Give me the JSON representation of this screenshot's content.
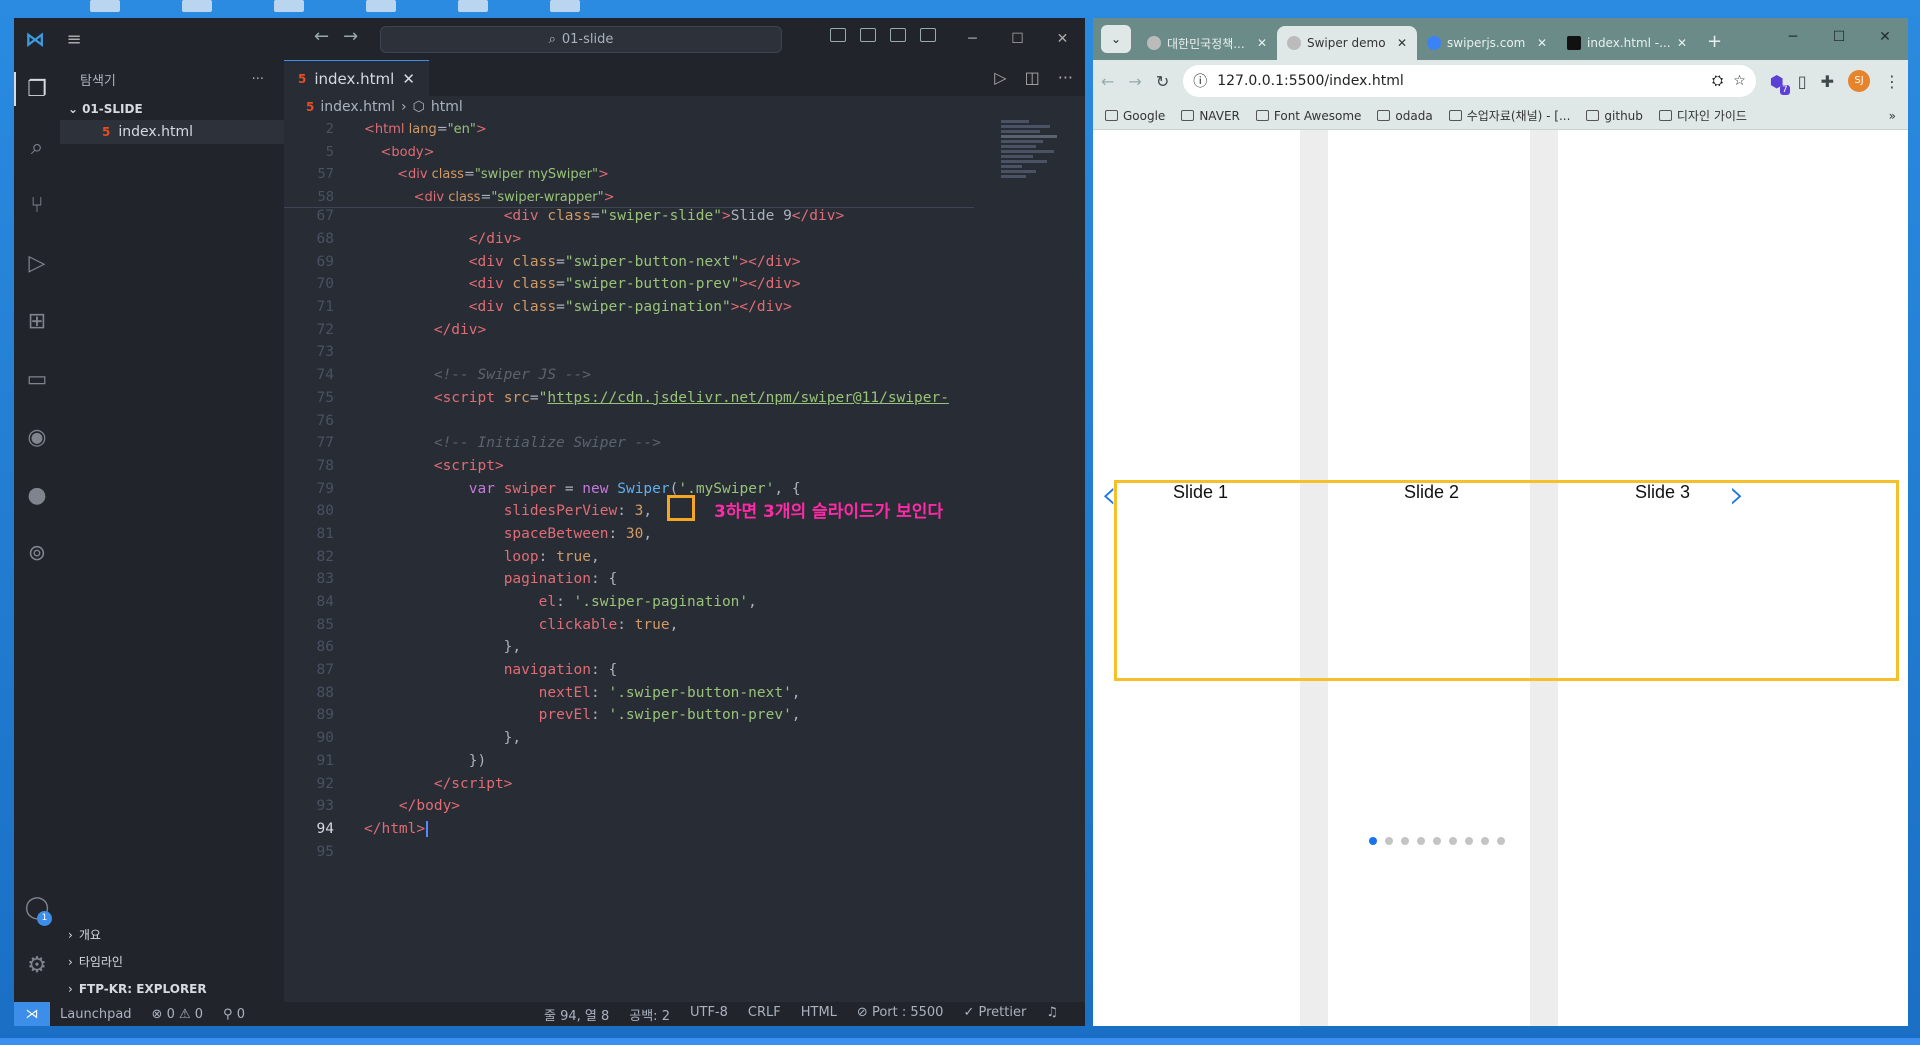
{
  "vscode": {
    "search_text": "01-slide",
    "explorer_title": "탐색기",
    "folder": "01-SLIDE",
    "file": "index.html",
    "tab_label": "index.html",
    "breadcrumb_file": "index.html",
    "breadcrumb_node": "html",
    "sections": [
      "개요",
      "타임라인",
      "FTP-KR: EXPLORER"
    ],
    "account_badge": "1",
    "annotation": "3하면 3개의 슬라이드가 보인다",
    "lines": [
      {
        "n": "2",
        "html": "<span class='tag'>&lt;html</span> <span class='attr'>lang</span>=<span class='str'>\"en\"</span><span class='tag'>&gt;</span>",
        "indent": 0
      },
      {
        "n": "5",
        "html": "<span class='tag'>&lt;body&gt;</span>",
        "indent": 1
      },
      {
        "n": "57",
        "html": "<span class='tag'>&lt;div</span> <span class='attr'>class</span>=<span class='str'>\"swiper mySwiper\"</span><span class='tag'>&gt;</span>",
        "indent": 2
      },
      {
        "n": "58",
        "html": "<span class='tag'>&lt;div</span> <span class='attr'>class</span>=<span class='str'>\"swiper-wrapper\"</span><span class='tag'>&gt;</span>",
        "indent": 3
      }
    ],
    "body_lines": [
      {
        "n": "67",
        "indent": 4,
        "html": "<span class='tag'>&lt;div</span> <span class='attr'>class</span>=<span class='str'>\"swiper-slide\"</span><span class='tag'>&gt;</span>Slide 9<span class='tag'>&lt;/div&gt;</span>"
      },
      {
        "n": "68",
        "indent": 3,
        "html": "<span class='tag'>&lt;/div&gt;</span>"
      },
      {
        "n": "69",
        "indent": 3,
        "html": "<span class='tag'>&lt;div</span> <span class='attr'>class</span>=<span class='str'>\"swiper-button-next\"</span><span class='tag'>&gt;&lt;/div&gt;</span>"
      },
      {
        "n": "70",
        "indent": 3,
        "html": "<span class='tag'>&lt;div</span> <span class='attr'>class</span>=<span class='str'>\"swiper-button-prev\"</span><span class='tag'>&gt;&lt;/div&gt;</span>"
      },
      {
        "n": "71",
        "indent": 3,
        "html": "<span class='tag'>&lt;div</span> <span class='attr'>class</span>=<span class='str'>\"swiper-pagination\"</span><span class='tag'>&gt;&lt;/div&gt;</span>"
      },
      {
        "n": "72",
        "indent": 2,
        "html": "<span class='tag'>&lt;/div&gt;</span>"
      },
      {
        "n": "73",
        "indent": 0,
        "html": ""
      },
      {
        "n": "74",
        "indent": 2,
        "html": "<span class='cmt'>&lt;!-- Swiper JS --&gt;</span>"
      },
      {
        "n": "75",
        "indent": 2,
        "html": "<span class='tag'>&lt;script</span> <span class='attr'>src</span>=<span class='str'>\"</span><span class='url'>https://cdn.jsdelivr.net/npm/swiper@11/swiper-</span>"
      },
      {
        "n": "76",
        "indent": 0,
        "html": ""
      },
      {
        "n": "77",
        "indent": 2,
        "html": "<span class='cmt'>&lt;!-- Initialize Swiper --&gt;</span>"
      },
      {
        "n": "78",
        "indent": 2,
        "html": "<span class='tag'>&lt;script&gt;</span>"
      },
      {
        "n": "79",
        "indent": 3,
        "html": "<span class='kw'>var</span> <span class='var'>swiper</span> = <span class='kw'>new</span> <span class='fn'>Swiper</span>(<span class='str'>'.mySwiper'</span>, {"
      },
      {
        "n": "80",
        "indent": 4,
        "html": "<span class='var'>slidesPerView</span>: <span class='num'>3</span>,"
      },
      {
        "n": "81",
        "indent": 4,
        "html": "<span class='var'>spaceBetween</span>: <span class='num'>30</span>,"
      },
      {
        "n": "82",
        "indent": 4,
        "html": "<span class='var'>loop</span>: <span class='num'>true</span>,"
      },
      {
        "n": "83",
        "indent": 4,
        "html": "<span class='var'>pagination</span>: {"
      },
      {
        "n": "84",
        "indent": 5,
        "html": "<span class='var'>el</span>: <span class='str'>'.swiper-pagination'</span>,"
      },
      {
        "n": "85",
        "indent": 5,
        "html": "<span class='var'>clickable</span>: <span class='num'>true</span>,"
      },
      {
        "n": "86",
        "indent": 4,
        "html": "},"
      },
      {
        "n": "87",
        "indent": 4,
        "html": "<span class='var'>navigation</span>: {"
      },
      {
        "n": "88",
        "indent": 5,
        "html": "<span class='var'>nextEl</span>: <span class='str'>'.swiper-button-next'</span>,"
      },
      {
        "n": "89",
        "indent": 5,
        "html": "<span class='var'>prevEl</span>: <span class='str'>'.swiper-button-prev'</span>,"
      },
      {
        "n": "90",
        "indent": 4,
        "html": "},"
      },
      {
        "n": "91",
        "indent": 3,
        "html": "})"
      },
      {
        "n": "92",
        "indent": 2,
        "html": "<span class='tag'>&lt;/script&gt;</span>"
      },
      {
        "n": "93",
        "indent": 1,
        "html": "<span class='tag'>&lt;/body&gt;</span>"
      },
      {
        "n": "94",
        "indent": 0,
        "html": "<span class='tag'>&lt;/html&gt;</span>",
        "current": true
      },
      {
        "n": "95",
        "indent": 0,
        "html": ""
      }
    ],
    "status": {
      "launchpad": "Launchpad",
      "problems": "⊗ 0 ⚠ 0",
      "ports": "⚲ 0",
      "position": "줄 94, 열 8",
      "spaces": "공백: 2",
      "encoding": "UTF-8",
      "eol": "CRLF",
      "language": "HTML",
      "port": "⊘ Port : 5500",
      "prettier": "✓ Prettier"
    }
  },
  "chrome": {
    "tabs": [
      "대한민국정책...",
      "Swiper demo",
      "swiperjs.com",
      "index.html -..."
    ],
    "url": "127.0.0.1:5500/index.html",
    "avatar": "SJ",
    "extension_badge": "7",
    "bookmarks": [
      "Google",
      "NAVER",
      "Font Awesome",
      "odada",
      "수업자료(채널) - [...",
      "github",
      "디자인 가이드"
    ],
    "slides": [
      "Slide 1",
      "Slide 2",
      "Slide 3"
    ],
    "pagination_count": 9,
    "pagination_active": 0
  }
}
